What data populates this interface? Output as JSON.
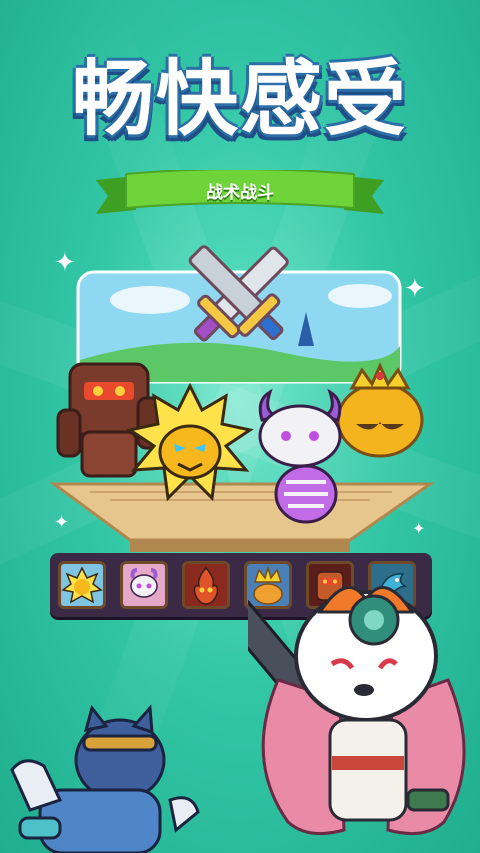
{
  "banner": {
    "title": "畅快感受",
    "subtitle": "战术战斗"
  },
  "colors": {
    "background": "#33c7a6",
    "title_outline": "#2c6fa8",
    "ribbon": "#6fd33a",
    "strip": "#3a2a45"
  },
  "scene": {
    "icon": "crossed-swords-icon",
    "characters": [
      "rock-golem",
      "lightning-lion",
      "bone-dragon",
      "royal-honey-pot",
      "fox-mask-warrior",
      "blue-cat-warrior"
    ]
  },
  "hero_slots": [
    {
      "icon": "lightning-lion-portrait-icon",
      "color": "#f7c520"
    },
    {
      "icon": "bone-dragon-portrait-icon",
      "color": "#b57ae0"
    },
    {
      "icon": "flame-spirit-portrait-icon",
      "color": "#e0542a"
    },
    {
      "icon": "crowned-king-portrait-icon",
      "color": "#f0a030"
    },
    {
      "icon": "rock-golem-portrait-icon",
      "color": "#c45a2a"
    },
    {
      "icon": "feather-bird-portrait-icon",
      "color": "#3fb0d6"
    }
  ]
}
